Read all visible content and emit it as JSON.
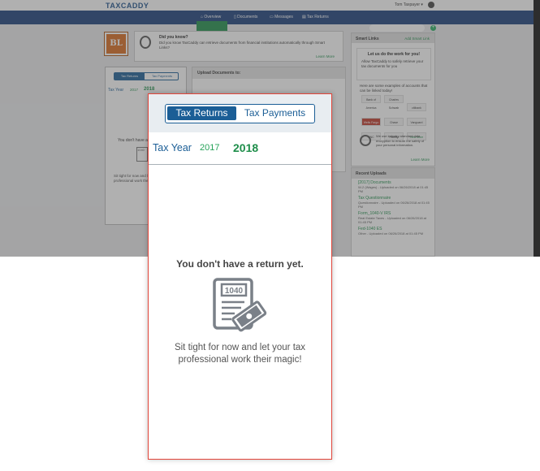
{
  "app": {
    "logo": "TAXCADDY",
    "user_name": "Tom Taxpayer"
  },
  "nav": {
    "items": [
      "Overview",
      "Documents",
      "Messages",
      "Tax Returns"
    ]
  },
  "did_you_know": {
    "title": "Did you know?",
    "text": "Did you know TaxCaddy can retrieve documents from financial institutions automatically through Smart Links?",
    "link": "Learn More"
  },
  "logo_badge": "BL",
  "smart_links": {
    "title": "Smart Links",
    "add_label": "Add Smart Link",
    "promo_title": "Let us do the work for you!",
    "promo_text": "Allow TaxCaddy to safely retrieve your tax documents for you",
    "examples_text": "Here are some examples of accounts that can be linked today!",
    "banks": [
      "Bank of America",
      "Charles Schwab",
      "citibank",
      "Wells Fargo",
      "Chase",
      "Vanguard",
      "PNC",
      "Fidelity",
      "View More"
    ],
    "security_text": "We use industry-standard data encryption to ensure the safety of your personal information.",
    "learn_more": "Learn More"
  },
  "recent_uploads": {
    "title": "Recent Uploads",
    "items": [
      {
        "name": "[2017] Documents",
        "sub": "W-2 (Wages) - Uploaded on 06/26/2018 at 01:45 PM"
      },
      {
        "name": "Tax Questionnaire",
        "sub": "Questionnaire - Uploaded on 06/26/2018 at 01:45 PM"
      },
      {
        "name": "Form_1040-V IRS",
        "sub": "Real Estate Taxes - Uploaded on 06/26/2018 at 01:45 PM"
      },
      {
        "name": "Fed-1040 ES",
        "sub": "Other - Uploaded on 06/26/2018 at 01:45 PM"
      }
    ]
  },
  "upload": {
    "title": "Upload Documents to:"
  },
  "returns_card": {
    "tab_active": "Tax Returns",
    "tab_inactive": "Tax Payments",
    "tax_year_label": "Tax Year",
    "year_prev": "2017",
    "year_current": "2018",
    "empty_title": "You don't have a return yet.",
    "icon_label": "1040",
    "empty_message": "Sit tight for now and let your tax professional work their magic!"
  },
  "colors": {
    "navy": "#1b3f7a",
    "blue": "#1b5e96",
    "green": "#1e8e4a",
    "orange": "#d96a1e",
    "highlight_border": "#e2453a"
  }
}
